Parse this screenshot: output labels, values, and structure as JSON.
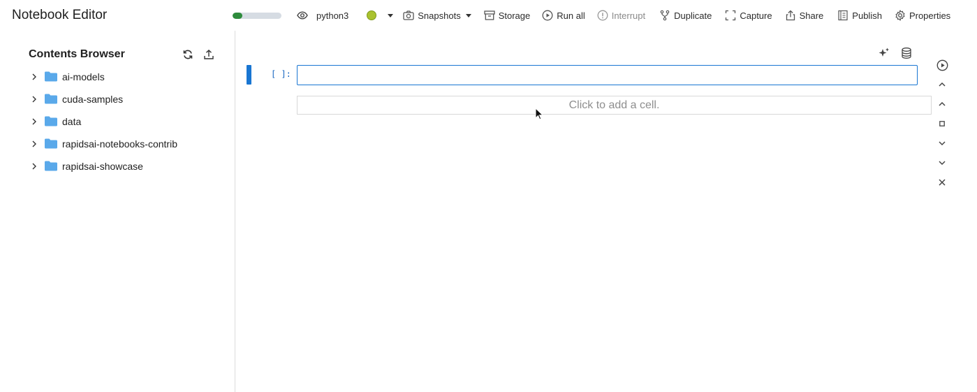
{
  "app": {
    "title": "Notebook Editor"
  },
  "toolbar": {
    "progress": 0.2,
    "kernel_name": "python3",
    "kernel_status_color": "#aac22f",
    "snapshots_label": "Snapshots",
    "storage_label": "Storage",
    "run_all_label": "Run all",
    "interrupt_label": "Interrupt",
    "duplicate_label": "Duplicate",
    "capture_label": "Capture",
    "share_label": "Share",
    "publish_label": "Publish",
    "properties_label": "Properties"
  },
  "sidebar": {
    "title": "Contents Browser",
    "items": [
      {
        "label": "ai-models",
        "icon": "folder-icon"
      },
      {
        "label": "cuda-samples",
        "icon": "folder-icon"
      },
      {
        "label": "data",
        "icon": "folder-icon"
      },
      {
        "label": "rapidsai-notebooks-contrib",
        "icon": "folder-icon"
      },
      {
        "label": "rapidsai-showcase",
        "icon": "folder-icon"
      }
    ]
  },
  "editor": {
    "cell_prompt": "[ ]:",
    "cell_value": "",
    "add_cell_text": "Click to add a cell."
  },
  "colors": {
    "accent": "#1976d2",
    "folder": "#5aa9ea",
    "progress_fill": "#2e8b3c",
    "progress_track": "#d6dce3"
  }
}
